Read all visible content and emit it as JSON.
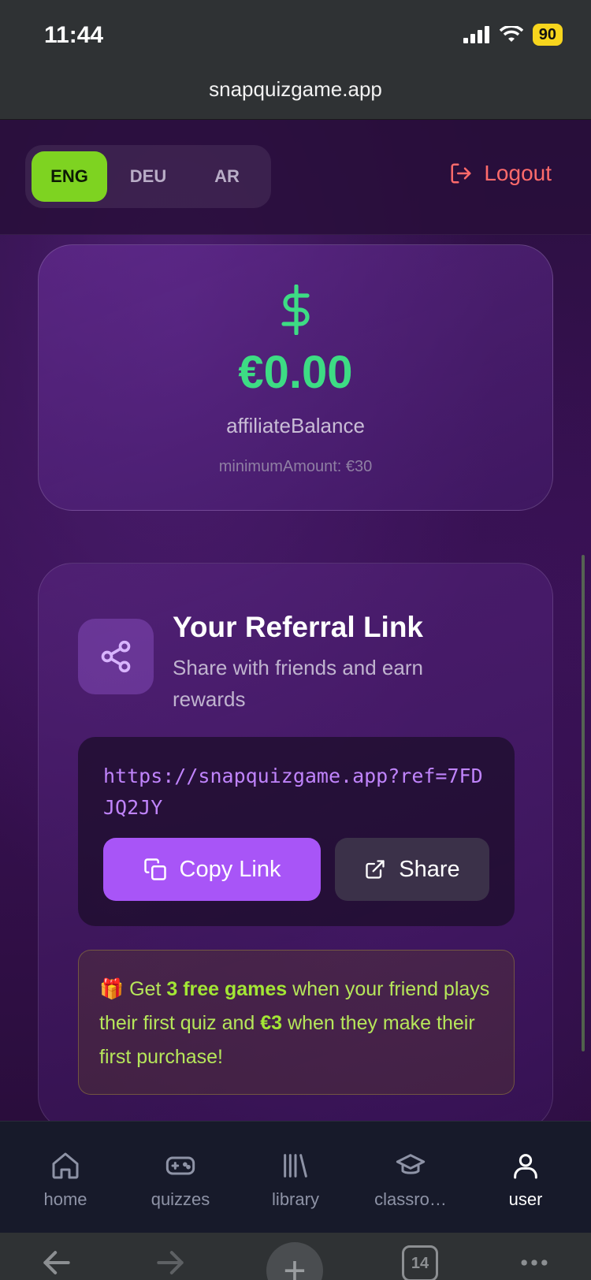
{
  "status_bar": {
    "time": "11:44",
    "battery": "90"
  },
  "browser": {
    "url": "snapquizgame.app",
    "tab_count": "14"
  },
  "languages": [
    {
      "code": "ENG",
      "active": true
    },
    {
      "code": "DEU",
      "active": false
    },
    {
      "code": "AR",
      "active": false
    }
  ],
  "header": {
    "logout_label": "Logout"
  },
  "balance": {
    "amount": "€0.00",
    "label": "affiliateBalance",
    "minimum": "minimumAmount: €30"
  },
  "referral": {
    "title": "Your Referral Link",
    "subtitle": "Share with friends and earn rewards",
    "link": "https://snapquizgame.app?ref=7FDJQ2JY",
    "copy_label": "Copy Link",
    "share_label": "Share",
    "promo": {
      "emoji": "🎁",
      "part1": "Get ",
      "bold1": "3 free games",
      "part2": " when your friend plays their first quiz and ",
      "bold2": "€3",
      "part3": " when they make their first purchase!"
    }
  },
  "nav": [
    {
      "label": "home",
      "icon": "home-icon",
      "active": false
    },
    {
      "label": "quizzes",
      "icon": "gamepad-icon",
      "active": false
    },
    {
      "label": "library",
      "icon": "library-icon",
      "active": false
    },
    {
      "label": "classro…",
      "icon": "graduation-cap-icon",
      "active": false
    },
    {
      "label": "user",
      "icon": "user-icon",
      "active": true
    }
  ],
  "colors": {
    "accent_green": "#3ddc84",
    "lang_active": "#7ed321",
    "logout_red": "#ff6b6b",
    "copy_button": "#a855f7",
    "link_text": "#c084fc",
    "promo_text": "#a3e635"
  }
}
